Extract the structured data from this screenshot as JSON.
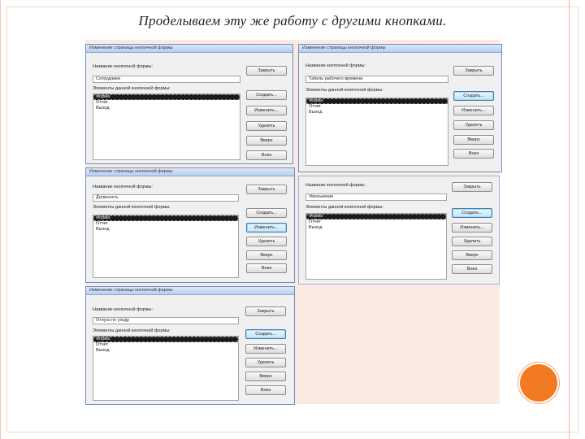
{
  "heading": "Проделываем эту же работу с другими кнопками.",
  "colors": {
    "accent_circle": "#f27a22",
    "peach_panel": "#fbeae2",
    "dialog_border": "#6b8fc7"
  },
  "dialogs": [
    {
      "title": "Изменение страницы кнопочной формы",
      "name_label": "Название кнопочной формы:",
      "name_value": "Сотрудники",
      "items_label": "Элементы данной кнопочной формы:",
      "items": [
        "Форма",
        "Отчет",
        "Выход"
      ],
      "buttons": [
        "Закрыть",
        "Создать...",
        "Изменить...",
        "Удалить",
        "Вверх",
        "Вниз"
      ]
    },
    {
      "title": "Изменение страницы кнопочной формы",
      "name_label": "Название кнопочной формы:",
      "name_value": "Табель рабочего времени",
      "items_label": "Элементы данной кнопочной формы:",
      "items": [
        "Форма",
        "Отчет",
        "Выход"
      ],
      "buttons": [
        "Закрыть",
        "Создать...",
        "Изменить...",
        "Удалить",
        "Вверх",
        "Вниз"
      ]
    },
    {
      "title": "Изменение страницы кнопочной формы",
      "name_label": "Название кнопочной формы:",
      "name_value": "Должность",
      "items_label": "Элементы данной кнопочной формы:",
      "items": [
        "Форма",
        "Отчет",
        "Выход"
      ],
      "buttons": [
        "Закрыть",
        "Создать...",
        "Изменить...",
        "Удалить",
        "Вверх",
        "Вниз"
      ]
    },
    {
      "title": "",
      "name_label": "Название кнопочной формы:",
      "name_value": "Увольнение",
      "items_label": "Элементы данной кнопочной формы:",
      "items": [
        "Форма",
        "Отчет",
        "Выход"
      ],
      "buttons": [
        "Закрыть",
        "Создать...",
        "Изменить...",
        "Удалить",
        "Вверх",
        "Вниз"
      ]
    },
    {
      "title": "Изменение страницы кнопочной формы",
      "name_label": "Название кнопочной формы:",
      "name_value": "Отпуск по уходу",
      "items_label": "Элементы данной кнопочной формы:",
      "items": [
        "Форма",
        "Отчет",
        "Выход"
      ],
      "buttons": [
        "Закрыть",
        "Создать...",
        "Изменить...",
        "Удалить",
        "Вверх",
        "Вниз"
      ]
    }
  ]
}
